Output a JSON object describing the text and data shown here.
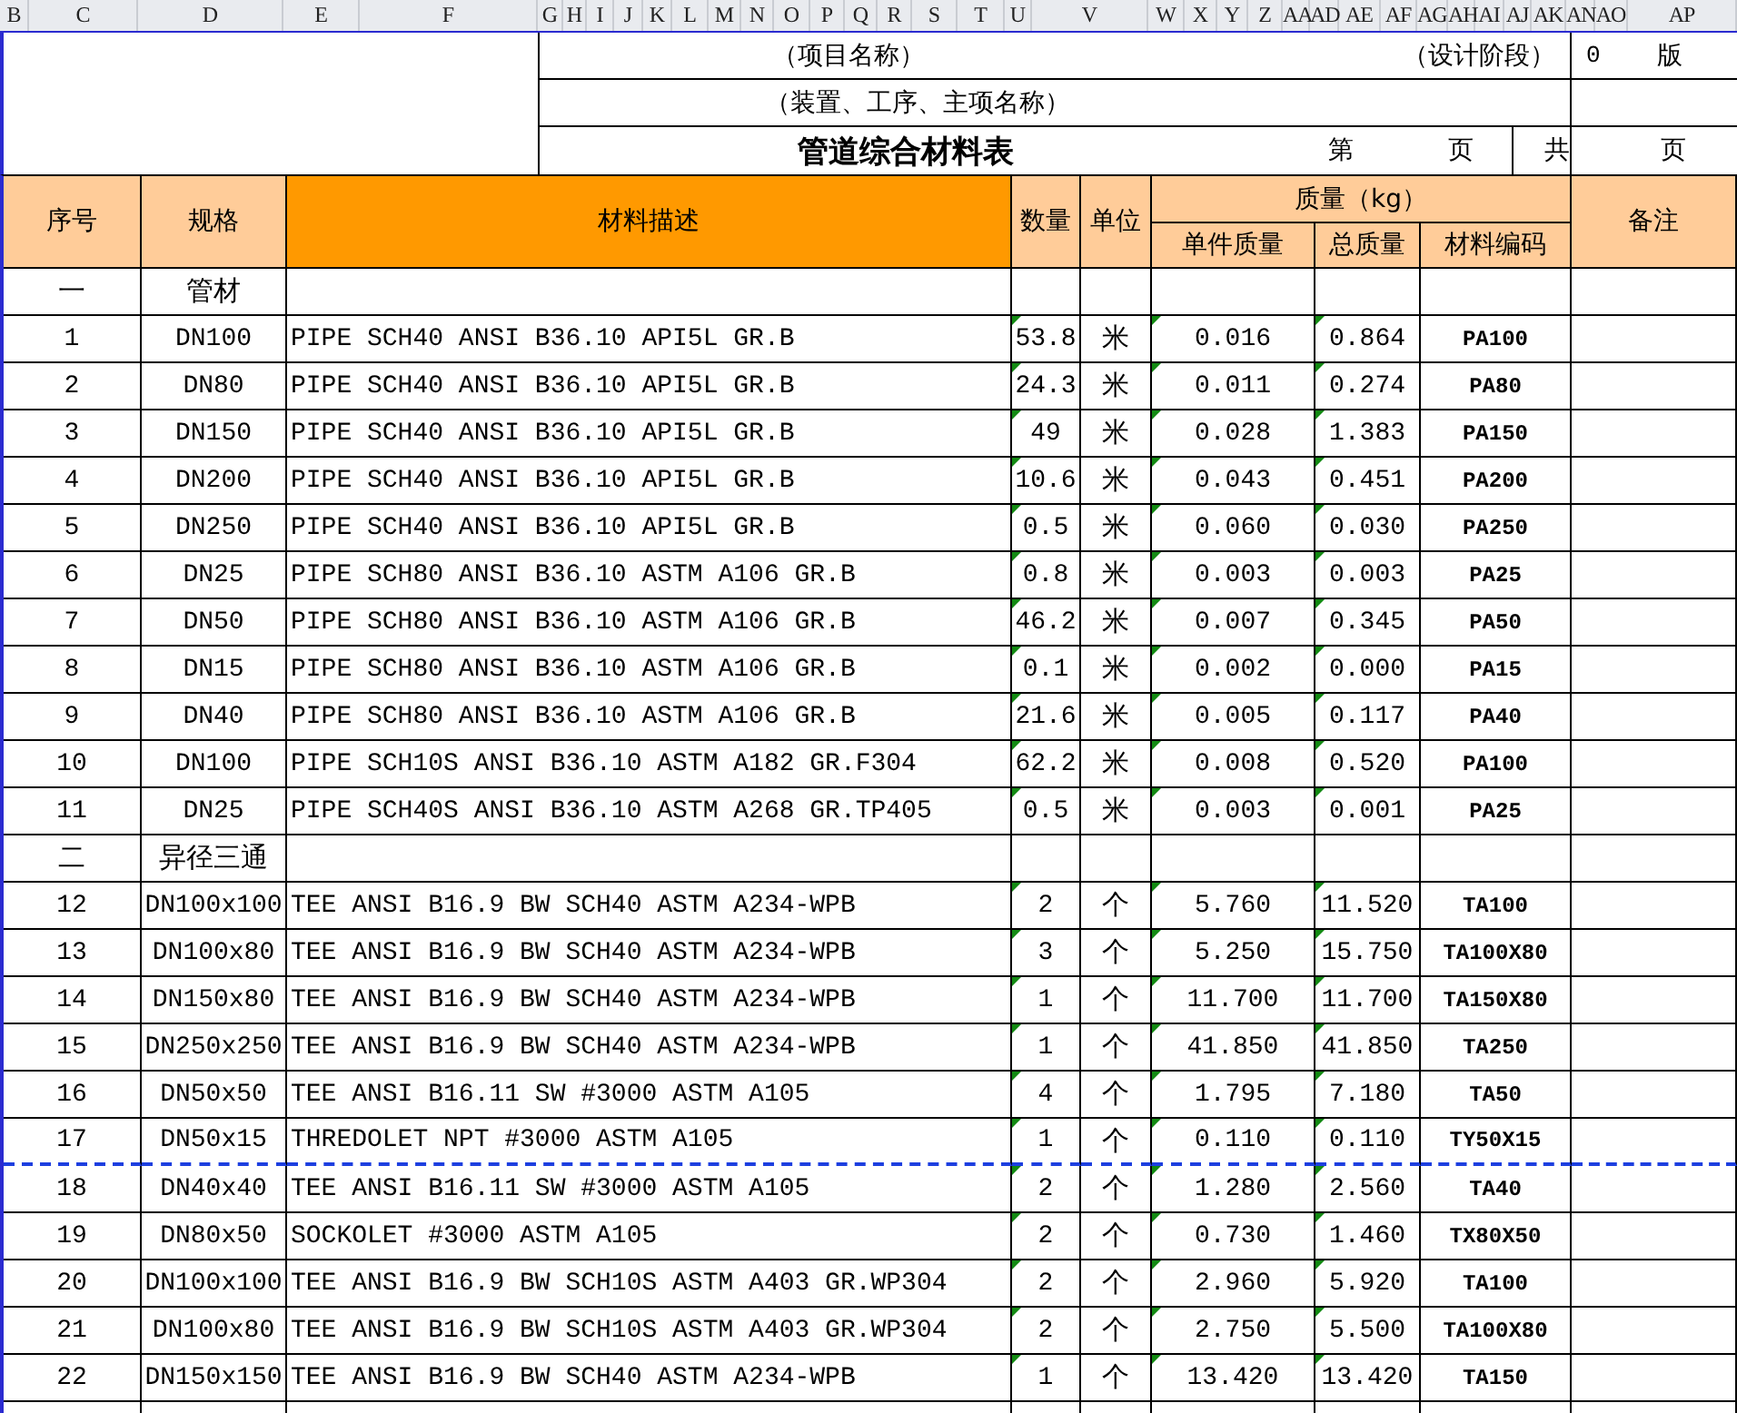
{
  "column_letters": [
    "B",
    "C",
    "D",
    "E",
    "F",
    "G",
    "H",
    "I",
    "J",
    "K",
    "L",
    "M",
    "N",
    "O",
    "P",
    "Q",
    "R",
    "S",
    "T",
    "U",
    "V",
    "W",
    "X",
    "Y",
    "Z",
    "AA",
    "AD",
    "AE",
    "AF",
    "AG",
    "AH",
    "AI",
    "AJ",
    "AK",
    "AN",
    "AO",
    "AP"
  ],
  "title_block": {
    "project_name": "（项目名称）",
    "design_stage": "（设计阶段）",
    "version_number": "0",
    "version_label": "版",
    "unit_name": "（装置、工序、主项名称）",
    "title": "管道综合材料表",
    "page_label": "第",
    "page_suffix": "页",
    "total_label": "共",
    "total_suffix": "页"
  },
  "header": {
    "no": "序号",
    "spec": "规格",
    "desc": "材料描述",
    "qty": "数量",
    "unit": "单位",
    "mass_group": "质量（kg）",
    "unit_mass": "单件质量",
    "total_mass": "总质量",
    "code": "材料编码",
    "remark": "备注"
  },
  "rows": [
    {
      "kind": "section",
      "no": "一",
      "spec": "管材"
    },
    {
      "kind": "item",
      "no": "1",
      "spec": "DN100",
      "desc": "PIPE SCH40 ANSI B36.10 API5L GR.B",
      "qty": "53.8",
      "unit": "米",
      "unit_mass": "0.016",
      "total_mass": "0.864",
      "code": "PA100",
      "flagged": true,
      "page_break_after": false
    },
    {
      "kind": "item",
      "no": "2",
      "spec": "DN80",
      "desc": "PIPE SCH40 ANSI B36.10 API5L GR.B",
      "qty": "24.3",
      "unit": "米",
      "unit_mass": "0.011",
      "total_mass": "0.274",
      "code": "PA80",
      "flagged": true,
      "page_break_after": false
    },
    {
      "kind": "item",
      "no": "3",
      "spec": "DN150",
      "desc": "PIPE SCH40 ANSI B36.10 API5L GR.B",
      "qty": "49",
      "unit": "米",
      "unit_mass": "0.028",
      "total_mass": "1.383",
      "code": "PA150",
      "flagged": true,
      "page_break_after": false
    },
    {
      "kind": "item",
      "no": "4",
      "spec": "DN200",
      "desc": "PIPE SCH40 ANSI B36.10 API5L GR.B",
      "qty": "10.6",
      "unit": "米",
      "unit_mass": "0.043",
      "total_mass": "0.451",
      "code": "PA200",
      "flagged": true,
      "page_break_after": false
    },
    {
      "kind": "item",
      "no": "5",
      "spec": "DN250",
      "desc": "PIPE SCH40 ANSI B36.10 API5L GR.B",
      "qty": "0.5",
      "unit": "米",
      "unit_mass": "0.060",
      "total_mass": "0.030",
      "code": "PA250",
      "flagged": true,
      "page_break_after": false
    },
    {
      "kind": "item",
      "no": "6",
      "spec": "DN25",
      "desc": "PIPE SCH80 ANSI B36.10 ASTM A106 GR.B",
      "qty": "0.8",
      "unit": "米",
      "unit_mass": "0.003",
      "total_mass": "0.003",
      "code": "PA25",
      "flagged": true,
      "page_break_after": false
    },
    {
      "kind": "item",
      "no": "7",
      "spec": "DN50",
      "desc": "PIPE SCH80 ANSI B36.10 ASTM A106 GR.B",
      "qty": "46.2",
      "unit": "米",
      "unit_mass": "0.007",
      "total_mass": "0.345",
      "code": "PA50",
      "flagged": true,
      "page_break_after": false
    },
    {
      "kind": "item",
      "no": "8",
      "spec": "DN15",
      "desc": "PIPE SCH80 ANSI B36.10 ASTM A106 GR.B",
      "qty": "0.1",
      "unit": "米",
      "unit_mass": "0.002",
      "total_mass": "0.000",
      "code": "PA15",
      "flagged": true,
      "page_break_after": false
    },
    {
      "kind": "item",
      "no": "9",
      "spec": "DN40",
      "desc": "PIPE SCH80 ANSI B36.10 ASTM A106 GR.B",
      "qty": "21.6",
      "unit": "米",
      "unit_mass": "0.005",
      "total_mass": "0.117",
      "code": "PA40",
      "flagged": true,
      "page_break_after": false
    },
    {
      "kind": "item",
      "no": "10",
      "spec": "DN100",
      "desc": "PIPE SCH10S ANSI B36.10 ASTM A182 GR.F304",
      "qty": "62.2",
      "unit": "米",
      "unit_mass": "0.008",
      "total_mass": "0.520",
      "code": "PA100",
      "flagged": true,
      "page_break_after": false
    },
    {
      "kind": "item",
      "no": "11",
      "spec": "DN25",
      "desc": "PIPE SCH40S ANSI B36.10 ASTM A268 GR.TP405",
      "qty": "0.5",
      "unit": "米",
      "unit_mass": "0.003",
      "total_mass": "0.001",
      "code": "PA25",
      "flagged": true,
      "page_break_after": false
    },
    {
      "kind": "section",
      "no": "二",
      "spec": "异径三通"
    },
    {
      "kind": "item",
      "no": "12",
      "spec": "DN100x100",
      "desc": "TEE ANSI B16.9 BW SCH40 ASTM A234-WPB",
      "qty": "2",
      "unit": "个",
      "unit_mass": "5.760",
      "total_mass": "11.520",
      "code": "TA100",
      "flagged": true,
      "page_break_after": false
    },
    {
      "kind": "item",
      "no": "13",
      "spec": "DN100x80",
      "desc": "TEE ANSI B16.9 BW SCH40 ASTM A234-WPB",
      "qty": "3",
      "unit": "个",
      "unit_mass": "5.250",
      "total_mass": "15.750",
      "code": "TA100X80",
      "flagged": true,
      "page_break_after": false
    },
    {
      "kind": "item",
      "no": "14",
      "spec": "DN150x80",
      "desc": "TEE ANSI B16.9 BW SCH40 ASTM A234-WPB",
      "qty": "1",
      "unit": "个",
      "unit_mass": "11.700",
      "total_mass": "11.700",
      "code": "TA150X80",
      "flagged": true,
      "page_break_after": false
    },
    {
      "kind": "item",
      "no": "15",
      "spec": "DN250x250",
      "desc": "TEE ANSI B16.9 BW SCH40 ASTM A234-WPB",
      "qty": "1",
      "unit": "个",
      "unit_mass": "41.850",
      "total_mass": "41.850",
      "code": "TA250",
      "flagged": true,
      "page_break_after": false
    },
    {
      "kind": "item",
      "no": "16",
      "spec": "DN50x50",
      "desc": "TEE ANSI B16.11 SW #3000 ASTM A105",
      "qty": "4",
      "unit": "个",
      "unit_mass": "1.795",
      "total_mass": "7.180",
      "code": "TA50",
      "flagged": true,
      "page_break_after": false
    },
    {
      "kind": "item",
      "no": "17",
      "spec": "DN50x15",
      "desc": "THREDOLET NPT #3000 ASTM A105",
      "qty": "1",
      "unit": "个",
      "unit_mass": "0.110",
      "total_mass": "0.110",
      "code": "TY50X15",
      "flagged": true,
      "page_break_after": true
    },
    {
      "kind": "item",
      "no": "18",
      "spec": "DN40x40",
      "desc": "TEE ANSI B16.11 SW #3000 ASTM A105",
      "qty": "2",
      "unit": "个",
      "unit_mass": "1.280",
      "total_mass": "2.560",
      "code": "TA40",
      "flagged": true,
      "page_break_after": false
    },
    {
      "kind": "item",
      "no": "19",
      "spec": "DN80x50",
      "desc": "SOCKOLET #3000 ASTM A105",
      "qty": "2",
      "unit": "个",
      "unit_mass": "0.730",
      "total_mass": "1.460",
      "code": "TX80X50",
      "flagged": true,
      "page_break_after": false
    },
    {
      "kind": "item",
      "no": "20",
      "spec": "DN100x100",
      "desc": "TEE ANSI B16.9 BW SCH10S ASTM A403 GR.WP304",
      "qty": "2",
      "unit": "个",
      "unit_mass": "2.960",
      "total_mass": "5.920",
      "code": "TA100",
      "flagged": true,
      "page_break_after": false
    },
    {
      "kind": "item",
      "no": "21",
      "spec": "DN100x80",
      "desc": "TEE ANSI B16.9 BW SCH10S ASTM A403 GR.WP304",
      "qty": "2",
      "unit": "个",
      "unit_mass": "2.750",
      "total_mass": "5.500",
      "code": "TA100X80",
      "flagged": true,
      "page_break_after": false
    },
    {
      "kind": "item",
      "no": "22",
      "spec": "DN150x150",
      "desc": "TEE ANSI B16.9 BW SCH40 ASTM A234-WPB",
      "qty": "1",
      "unit": "个",
      "unit_mass": "13.420",
      "total_mass": "13.420",
      "code": "TA150",
      "flagged": true,
      "page_break_after": false
    }
  ]
}
